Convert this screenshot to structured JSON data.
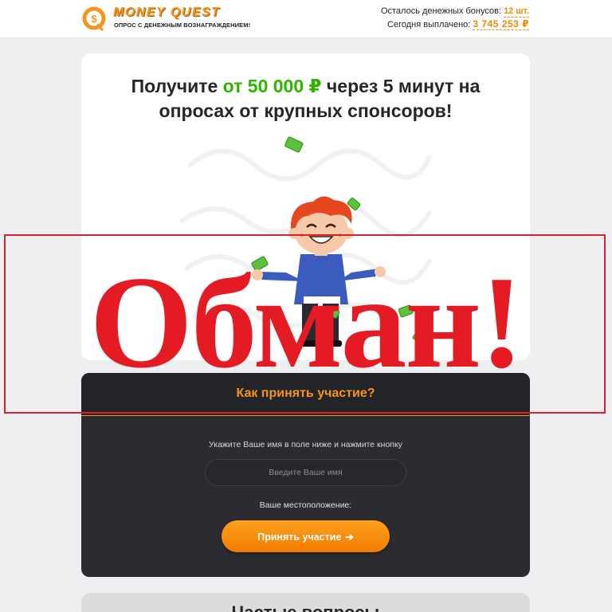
{
  "header": {
    "logo_title": "MONEY QUEST",
    "logo_subtitle": "ОПРОС С ДЕНЕЖНЫМ ВОЗНАГРАЖДЕНИЕМ!",
    "bonuses_label": "Осталось денежных бонусов:",
    "bonuses_value": "12 шт.",
    "paid_label": "Сегодня выплачено:",
    "paid_value": "3 745 253 ₽"
  },
  "hero": {
    "title_part1": "Получите ",
    "title_accent": "от 50 000 ₽",
    "title_part2": " через 5 минут на",
    "title_line2": "опросах от крупных спонсоров!"
  },
  "participate": {
    "title": "Как принять участие?",
    "hint": "Укажите Ваше имя в поле ниже и нажмите кнопку",
    "name_placeholder": "Введите Ваше имя",
    "location_label": "Ваше местоположение:",
    "cta_label": "Принять участие",
    "cta_icon": "➔"
  },
  "next_card": {
    "title": "Частые вопросы"
  },
  "overlay": {
    "stamp": "Обман!"
  },
  "colors": {
    "accent_orange": "#f7941d",
    "accent_green": "#2db400",
    "stamp_red": "#e51b24",
    "dark_card": "#2a2c31"
  },
  "icons": [
    "logo-money-quest-icon",
    "arrow-right-icon",
    "boy-money-illustration"
  ]
}
